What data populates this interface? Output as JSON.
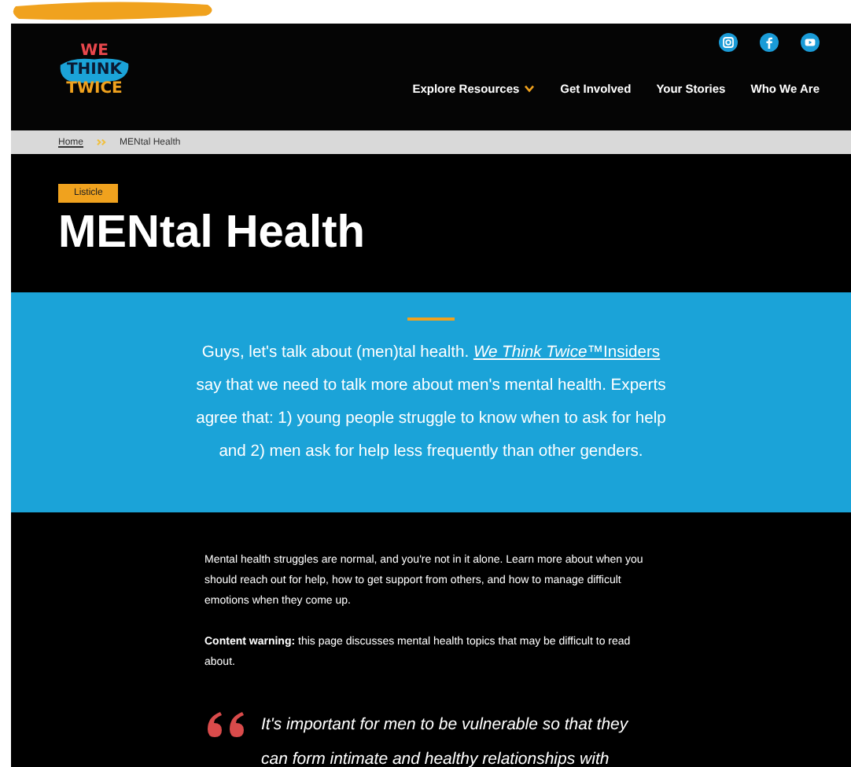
{
  "logo": {
    "lines": [
      "WE",
      "THINK",
      "TWICE"
    ]
  },
  "social_icons": [
    {
      "kind": "instagram"
    },
    {
      "kind": "facebook"
    },
    {
      "kind": "youtube"
    }
  ],
  "nav": [
    {
      "label": "Explore Resources",
      "has_dropdown": true
    },
    {
      "label": "Get Involved",
      "has_dropdown": false
    },
    {
      "label": "Your Stories",
      "has_dropdown": false
    },
    {
      "label": "Who We Are",
      "has_dropdown": false
    }
  ],
  "breadcrumb": {
    "home": "Home",
    "current": "MENtal Health"
  },
  "hero": {
    "badge": "Listicle",
    "title": "MENtal Health"
  },
  "intro": {
    "before": "Guys, let's talk about (men)tal health. ",
    "link_italic": "We Think Twice™",
    "link_rest": "Insiders",
    "after": " say that we need to talk more about men's mental health. Experts agree that: 1) young people struggle to know when to ask for help and 2) men ask for help less frequently than other genders."
  },
  "body": [
    "Mental health struggles are normal, and you're not in it alone. Learn more about when you should reach out for help, how to get support from others, and how to manage difficult emotions when they come up.",
    "**Content warning:** this page discusses mental health topics that may be difficult to read about."
  ],
  "quote": "It's important for men to be vulnerable so that they can form intimate and healthy relationships with"
}
